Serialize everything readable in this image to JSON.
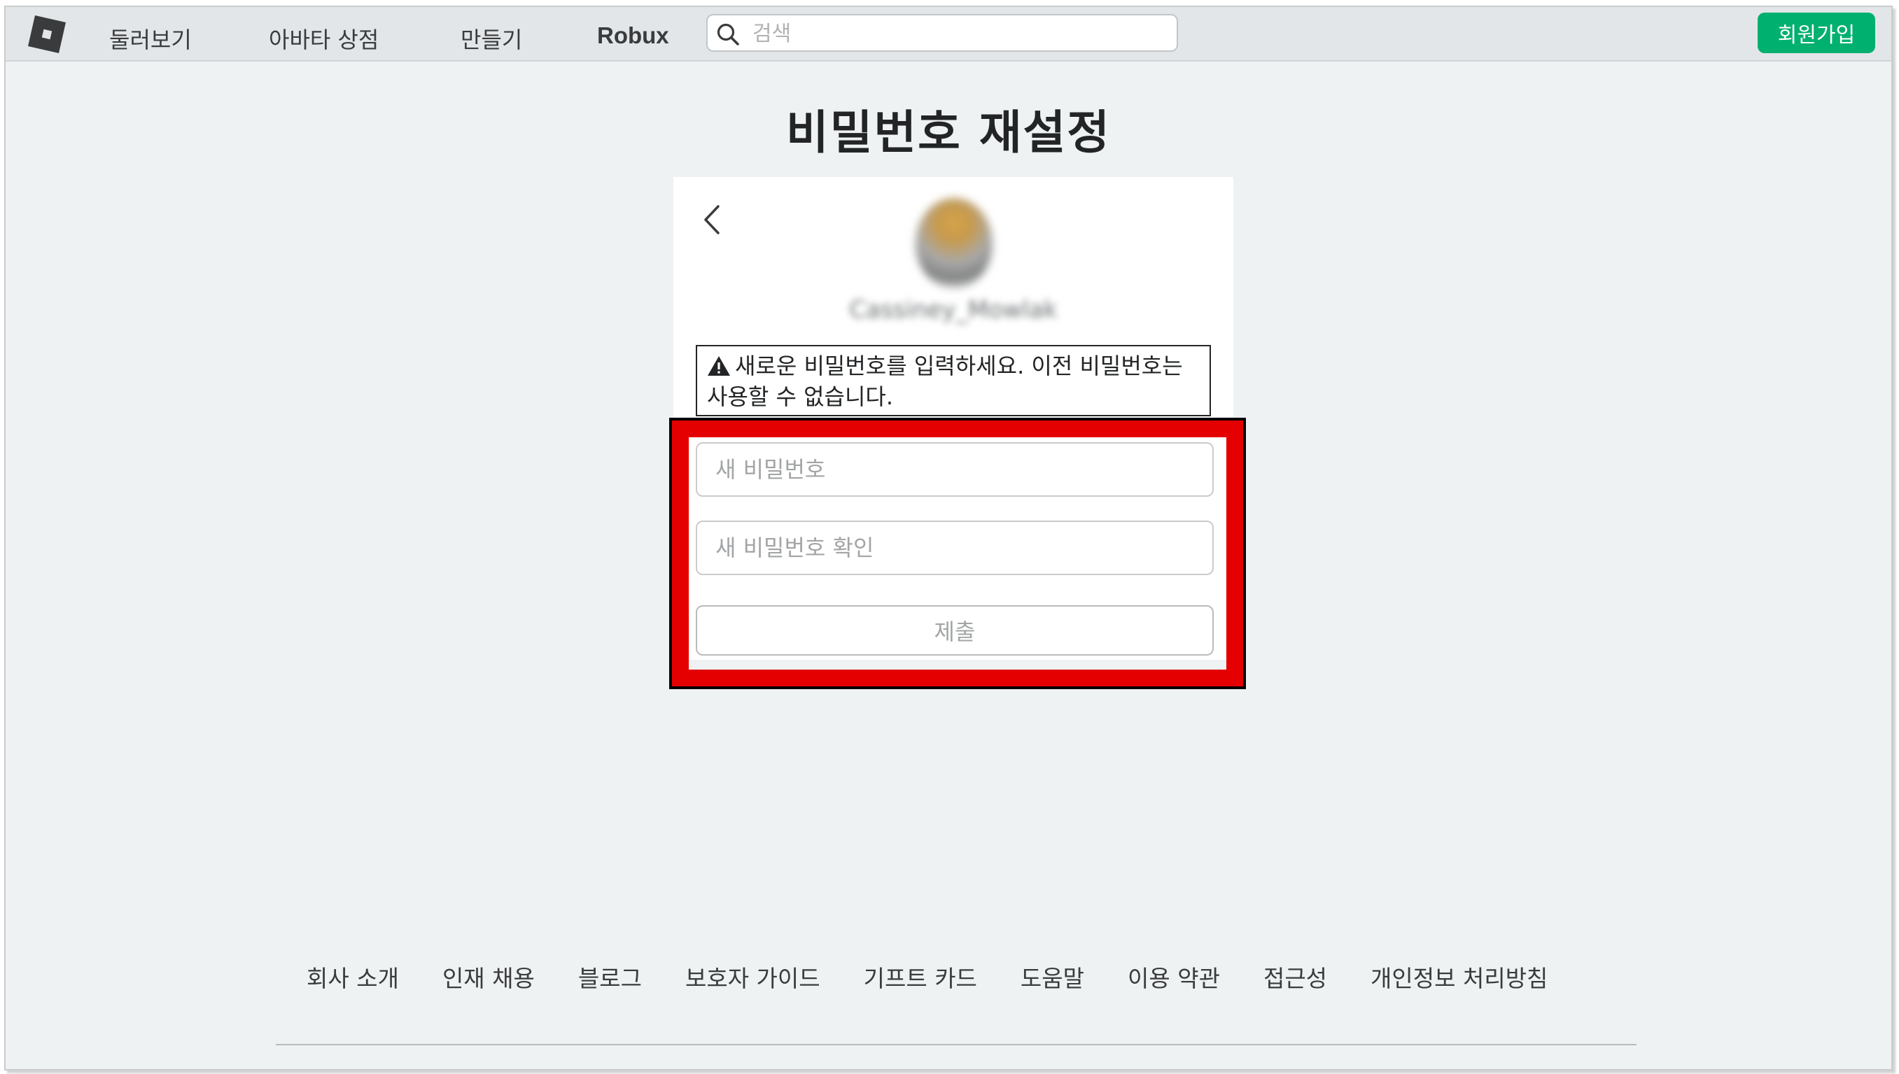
{
  "nav": {
    "items": [
      {
        "label": "둘러보기"
      },
      {
        "label": "아바타 상점"
      },
      {
        "label": "만들기"
      },
      {
        "label": "Robux"
      }
    ],
    "search_placeholder": "검색",
    "signup_label": "회원가입"
  },
  "page": {
    "title": "비밀번호 재설정",
    "username": "Cassiney_Mowlak",
    "warning": "새로운 비밀번호를 입력하세요. 이전 비밀번호는 사용할 수 없습니다.",
    "new_password_placeholder": "새 비밀번호",
    "confirm_password_placeholder": "새 비밀번호 확인",
    "submit_label": "제출"
  },
  "footer": {
    "links": [
      {
        "label": "회사 소개"
      },
      {
        "label": "인재 채용"
      },
      {
        "label": "블로그"
      },
      {
        "label": "보호자 가이드"
      },
      {
        "label": "기프트 카드"
      },
      {
        "label": "도움말"
      },
      {
        "label": "이용 약관"
      },
      {
        "label": "접근성"
      },
      {
        "label": "개인정보 처리방침"
      }
    ]
  },
  "colors": {
    "background": "#eff2f3",
    "topbar": "#e3e6e8",
    "signup_green": "#00b06f",
    "highlight_red": "#e40000"
  },
  "icons": [
    "roblox-logo-icon",
    "search-icon",
    "back-chevron-icon",
    "warning-triangle-icon"
  ]
}
